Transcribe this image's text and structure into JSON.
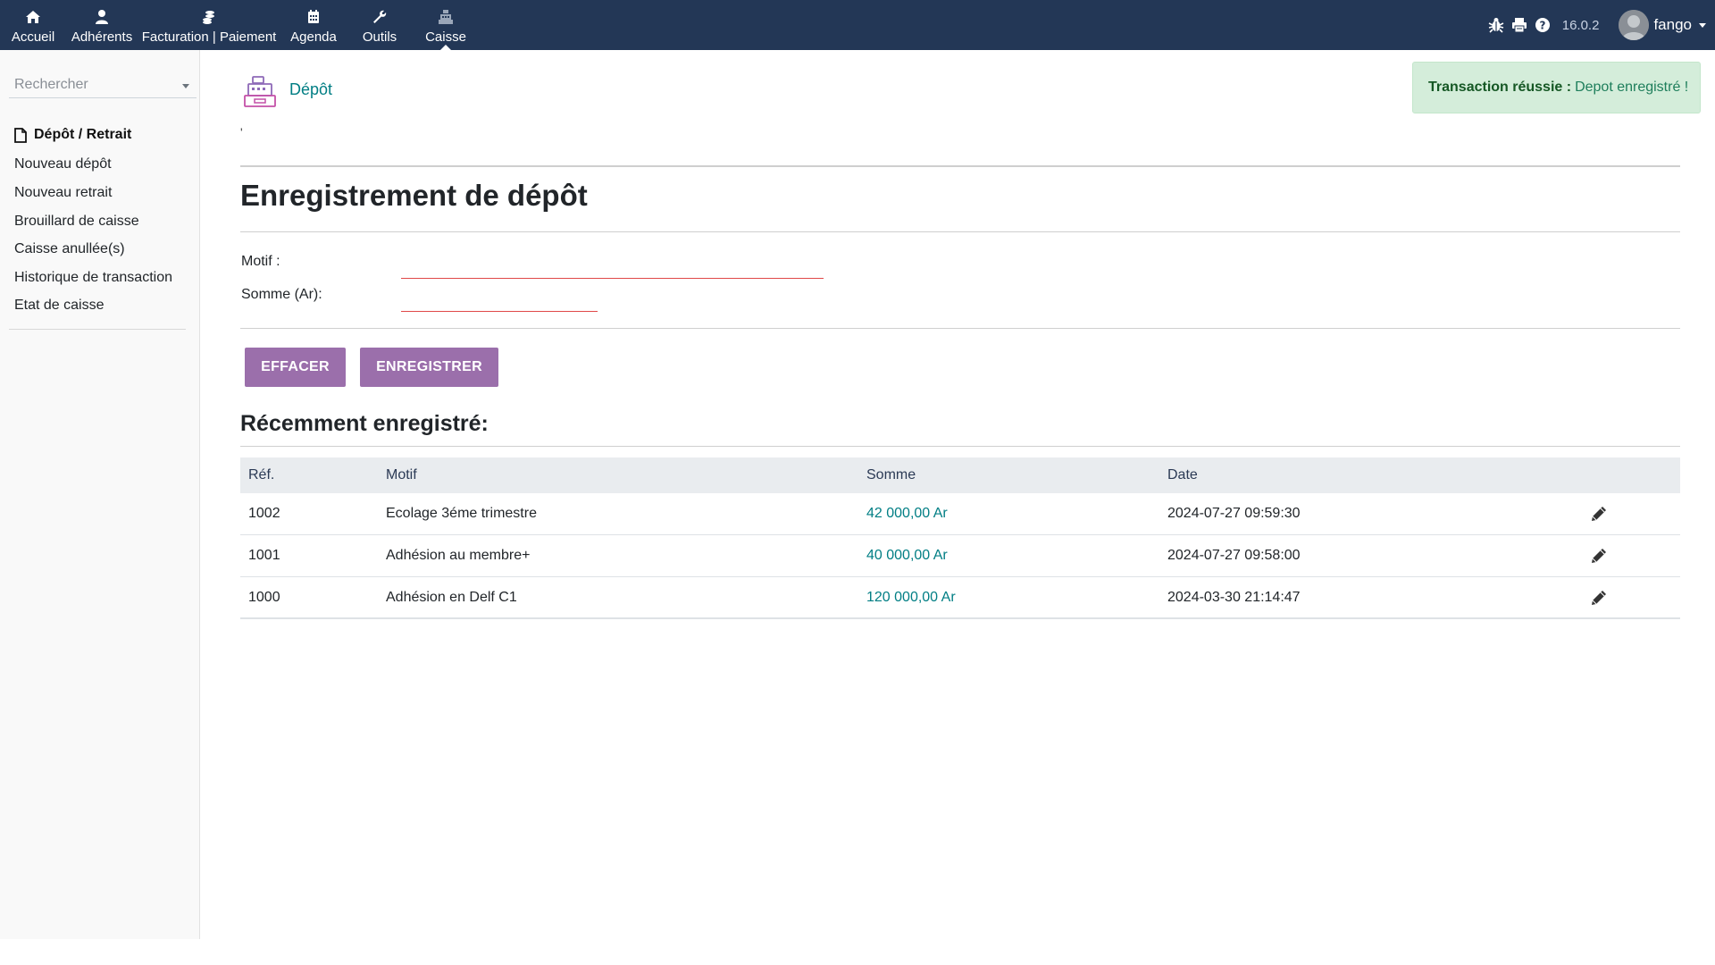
{
  "topbar": {
    "nav": [
      {
        "label": "Accueil",
        "icon": "home-icon"
      },
      {
        "label": "Adhérents",
        "icon": "user-icon"
      },
      {
        "label": "Facturation | Paiement",
        "icon": "coins-icon"
      },
      {
        "label": "Agenda",
        "icon": "calendar-icon"
      },
      {
        "label": "Outils",
        "icon": "wrench-icon"
      },
      {
        "label": "Caisse",
        "icon": "cash-register-icon"
      }
    ],
    "active_nav": "Caisse",
    "version": "16.0.2",
    "user": "fango",
    "icons": [
      "bug-icon",
      "print-icon",
      "help-icon"
    ]
  },
  "sidebar": {
    "search_placeholder": "Rechercher",
    "section_title": "Dépôt / Retrait",
    "links": [
      "Nouveau dépôt",
      "Nouveau retrait",
      "Brouillard de caisse",
      "Caisse anullée(s)",
      "Historique de transaction",
      "Etat de caisse"
    ]
  },
  "header": {
    "title": "Dépôt",
    "tick": "'"
  },
  "alert": {
    "label": "Transaction réussie :",
    "message": "Depot enregistré !",
    "color": "#d4edda"
  },
  "form": {
    "title": "Enregistrement de dépôt",
    "motif_label": "Motif :",
    "somme_label": "Somme (Ar):",
    "motif_value": "",
    "somme_value": ""
  },
  "buttons": {
    "clear": "EFFACER",
    "save": "ENREGISTRER",
    "color": "#9b6fab"
  },
  "recent": {
    "title": "Récemment enregistré:",
    "columns": [
      "Réf.",
      "Motif",
      "Somme",
      "Date"
    ],
    "rows": [
      {
        "ref": "1002",
        "motif": "Ecolage 3éme trimestre",
        "somme": "42 000,00 Ar",
        "date": "2024-07-27 09:59:30"
      },
      {
        "ref": "1001",
        "motif": "Adhésion au membre+",
        "somme": "40 000,00 Ar",
        "date": "2024-07-27 09:58:00"
      },
      {
        "ref": "1000",
        "motif": "Adhésion en Delf C1",
        "somme": "120 000,00 Ar",
        "date": "2024-03-30 21:14:47"
      }
    ]
  }
}
